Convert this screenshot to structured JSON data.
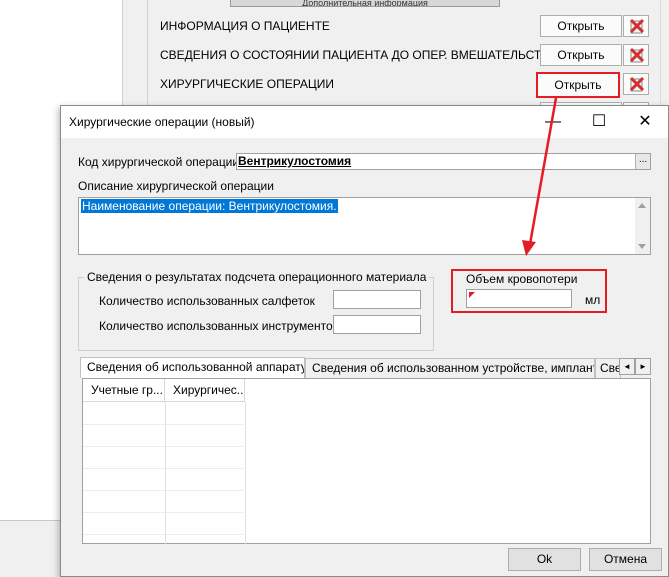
{
  "background": {
    "header_text": "Дополнительная информация",
    "rows": [
      {
        "label": "ИНФОРМАЦИЯ О ПАЦИЕНТЕ",
        "button": "Открыть"
      },
      {
        "label": "СВЕДЕНИЯ О СОСТОЯНИИ ПАЦИЕНТА ДО ОПЕР. ВМЕШАТЕЛЬСТВА",
        "button": "Открыть"
      },
      {
        "label": "ХИРУРГИЧЕСКИЕ ОПЕРАЦИИ",
        "button": "Открыть"
      }
    ]
  },
  "dialog": {
    "title": "Хирургические операции (новый)",
    "window_buttons": {
      "minimize": "—",
      "maximize": "☐",
      "close": "✕"
    },
    "code_label": "Код хирургической операции",
    "code_value": "Вентрикулостомия",
    "ellipsis": "...",
    "desc_label": "Описание хирургической операции",
    "desc_value": "Наименование операции: Вентрикулостомия.",
    "count_group_title": "Сведения о результатах подсчета операционного материала",
    "napkins_label": "Количество использованных салфеток",
    "napkins_value": "",
    "instruments_label": "Количество использованных инструментов",
    "instruments_value": "",
    "blood_loss_label": "Объем кровопотери",
    "blood_loss_value": "",
    "blood_loss_unit": "мл",
    "tabs": [
      "Сведения об использованной аппаратуре",
      "Сведения об использованном устройстве, имплантате",
      "Све"
    ],
    "tab_scroll": {
      "left": "◄",
      "right": "►"
    },
    "grid_columns": [
      "Учетные гр...",
      "Хирургичес..."
    ],
    "ok_label": "Ok",
    "cancel_label": "Отмена"
  },
  "colors": {
    "highlight": "#e51c23",
    "selection": "#0078d7"
  }
}
